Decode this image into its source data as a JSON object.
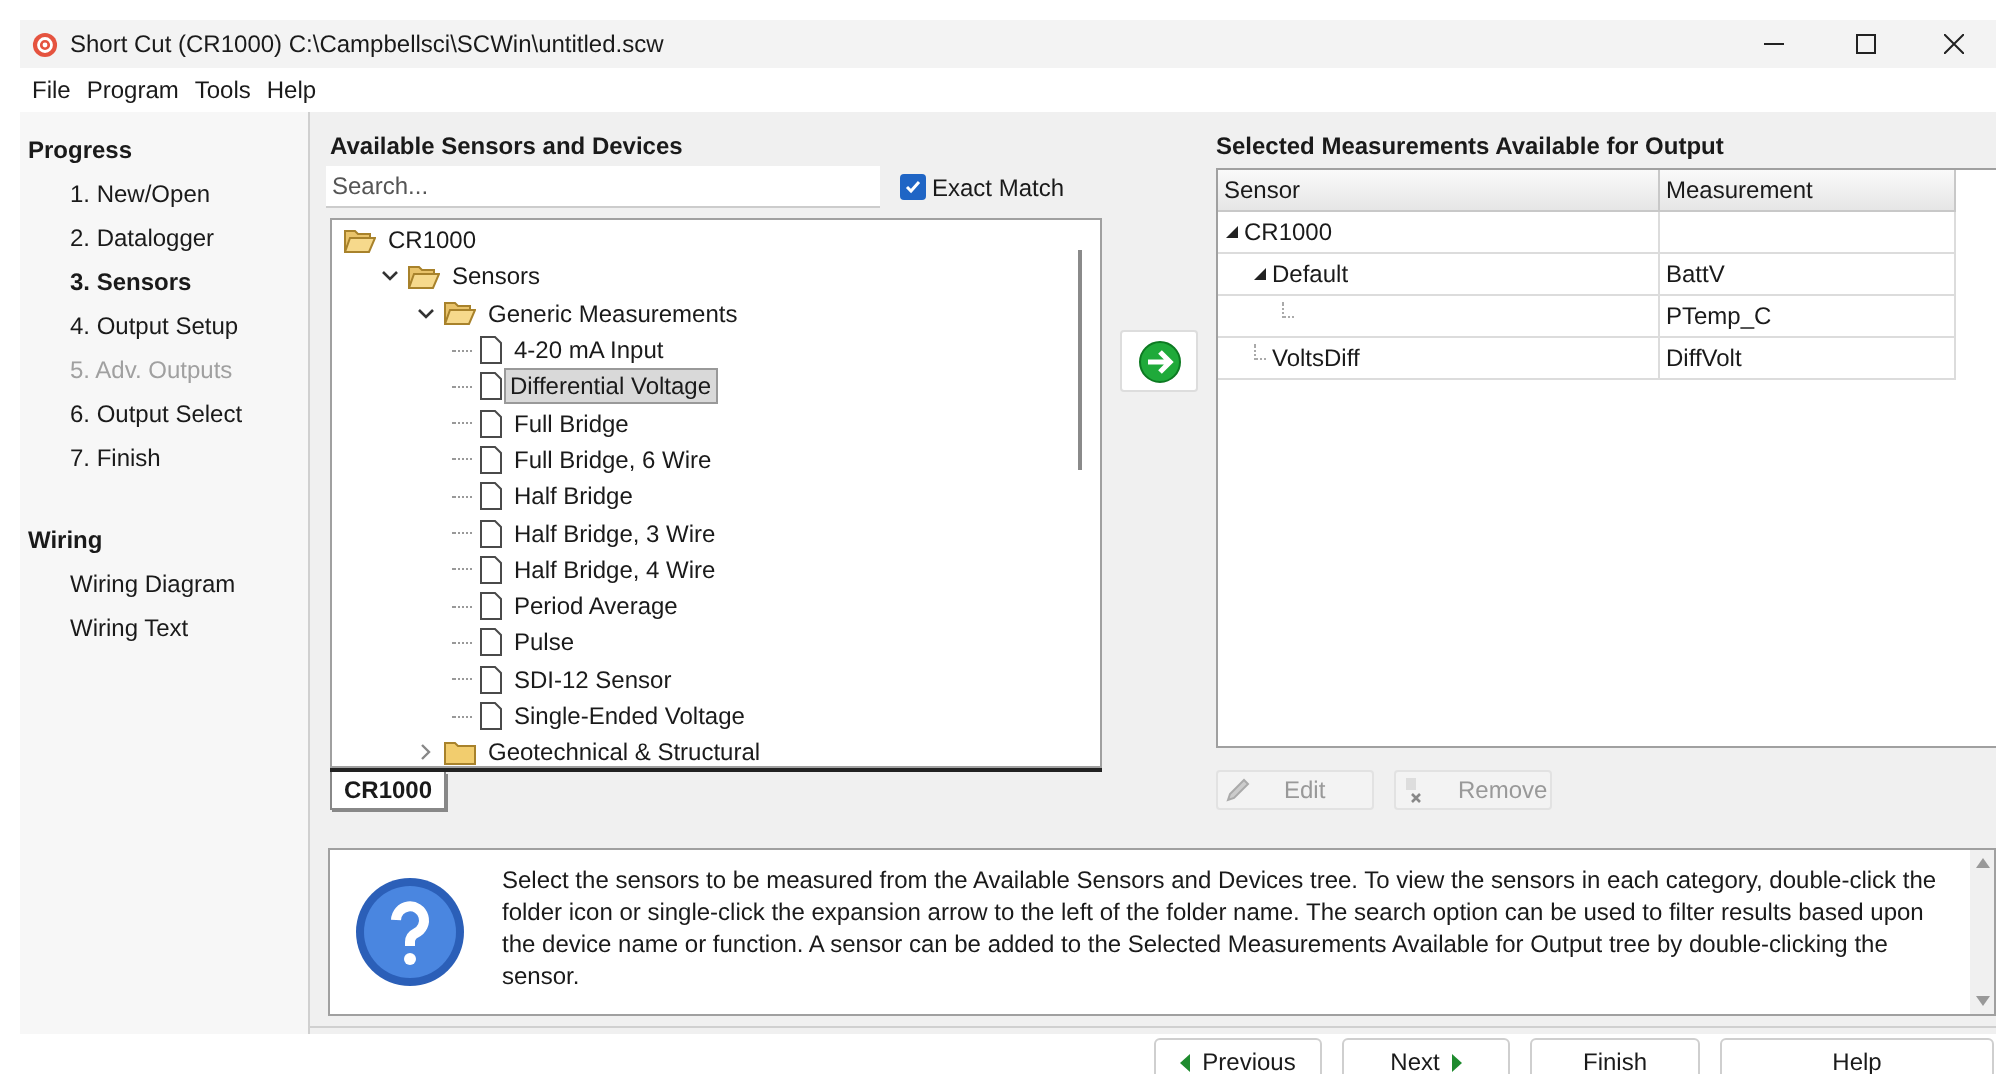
{
  "window": {
    "title": "Short Cut (CR1000) C:\\Campbellsci\\SCWin\\untitled.scw"
  },
  "menu": [
    "File",
    "Program",
    "Tools",
    "Help"
  ],
  "sidebar": {
    "sections": [
      {
        "title": "Progress",
        "items": [
          {
            "label": "1. New/Open",
            "selected": false,
            "disabled": false
          },
          {
            "label": "2. Datalogger",
            "selected": false,
            "disabled": false
          },
          {
            "label": "3. Sensors",
            "selected": true,
            "disabled": false
          },
          {
            "label": "4. Output Setup",
            "selected": false,
            "disabled": false
          },
          {
            "label": "5. Adv. Outputs",
            "selected": false,
            "disabled": true
          },
          {
            "label": "6. Output Select",
            "selected": false,
            "disabled": false
          },
          {
            "label": "7. Finish",
            "selected": false,
            "disabled": false
          }
        ]
      },
      {
        "title": "Wiring",
        "items": [
          {
            "label": "Wiring Diagram",
            "selected": false,
            "disabled": false
          },
          {
            "label": "Wiring Text",
            "selected": false,
            "disabled": false
          }
        ]
      }
    ]
  },
  "available": {
    "title": "Available Sensors and Devices",
    "search": {
      "placeholder": "Search..."
    },
    "exact_match": {
      "label": "Exact Match",
      "checked": true
    },
    "tree": [
      {
        "label": "CR1000",
        "kind": "folder",
        "expanded": true,
        "children": [
          {
            "label": "Sensors",
            "kind": "folder",
            "expanded": true,
            "children": [
              {
                "label": "Generic Measurements",
                "kind": "folder",
                "expanded": true,
                "children": [
                  {
                    "label": "4-20 mA Input",
                    "kind": "sensor",
                    "selected": false
                  },
                  {
                    "label": "Differential Voltage",
                    "kind": "sensor",
                    "selected": true
                  },
                  {
                    "label": "Full Bridge",
                    "kind": "sensor",
                    "selected": false
                  },
                  {
                    "label": "Full Bridge, 6 Wire",
                    "kind": "sensor",
                    "selected": false
                  },
                  {
                    "label": "Half Bridge",
                    "kind": "sensor",
                    "selected": false
                  },
                  {
                    "label": "Half Bridge, 3 Wire",
                    "kind": "sensor",
                    "selected": false
                  },
                  {
                    "label": "Half Bridge, 4 Wire",
                    "kind": "sensor",
                    "selected": false
                  },
                  {
                    "label": "Period Average",
                    "kind": "sensor",
                    "selected": false
                  },
                  {
                    "label": "Pulse",
                    "kind": "sensor",
                    "selected": false
                  },
                  {
                    "label": "SDI-12 Sensor",
                    "kind": "sensor",
                    "selected": false
                  },
                  {
                    "label": "Single-Ended Voltage",
                    "kind": "sensor",
                    "selected": false
                  }
                ]
              },
              {
                "label": "Geotechnical & Structural",
                "kind": "folder",
                "expanded": false
              }
            ]
          }
        ]
      }
    ],
    "tabs": [
      {
        "label": "CR1000",
        "selected": true
      }
    ]
  },
  "selected_output": {
    "title": "Selected Measurements Available for Output",
    "columns": [
      "Sensor",
      "Measurement"
    ],
    "rows": [
      {
        "sensor": "CR1000",
        "expanded": true,
        "children": [
          {
            "sensor": "Default",
            "measurement": "BattV",
            "expanded": true,
            "children": [
              {
                "measurement": "PTemp_C"
              }
            ]
          },
          {
            "sensor": "VoltsDiff",
            "measurement": "DiffVolt"
          }
        ]
      }
    ],
    "buttons": [
      {
        "label": "Edit",
        "kind": "edit",
        "disabled": true
      },
      {
        "label": "Remove",
        "kind": "remove",
        "disabled": true
      }
    ]
  },
  "help_text": "Select the sensors to be measured from the Available Sensors and Devices tree. To view the sensors in each category, double-click the folder icon or single-click the expansion arrow to the left of the folder name. The search option can be used to filter results based upon the device name or function. A sensor can be added to the Selected Measurements Available for Output tree by double-clicking the sensor.",
  "nav_buttons": [
    {
      "label": "Previous",
      "kind": "previous"
    },
    {
      "label": "Next",
      "kind": "next"
    },
    {
      "label": "Finish",
      "kind": "plain"
    },
    {
      "label": "Help",
      "kind": "plain"
    }
  ]
}
